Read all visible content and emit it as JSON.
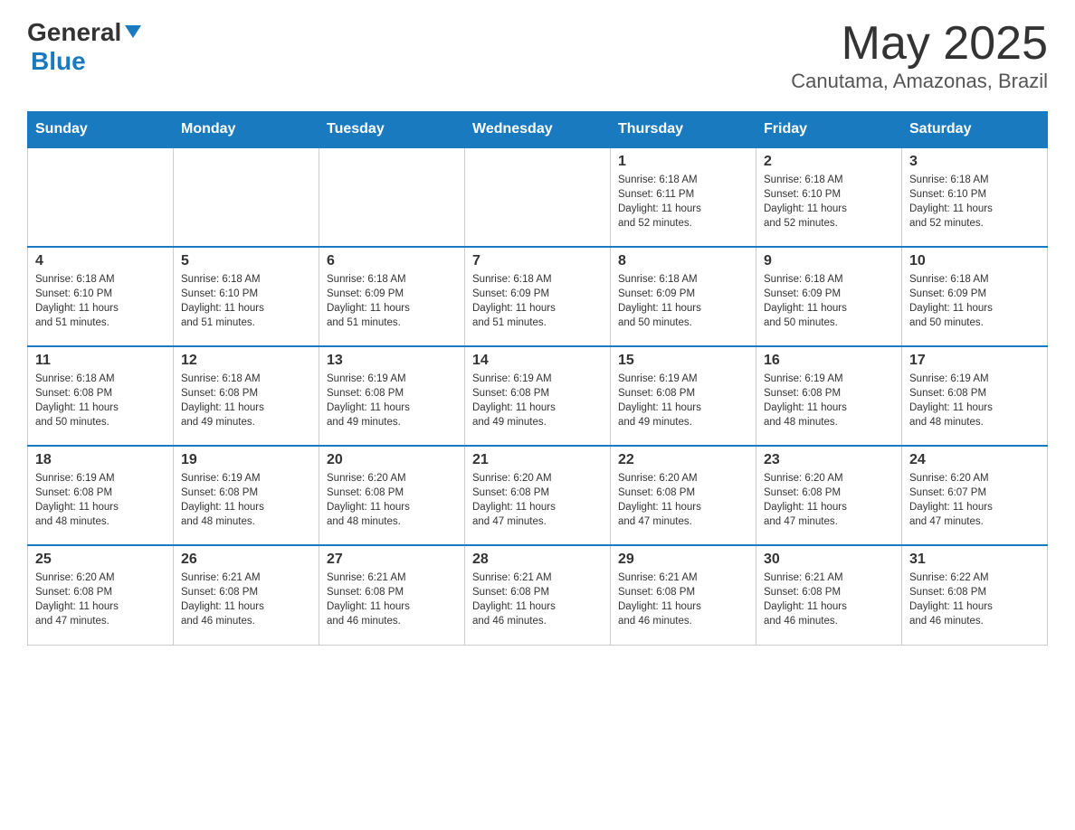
{
  "header": {
    "logo_general": "General",
    "logo_blue": "Blue",
    "month": "May 2025",
    "location": "Canutama, Amazonas, Brazil"
  },
  "days_of_week": [
    "Sunday",
    "Monday",
    "Tuesday",
    "Wednesday",
    "Thursday",
    "Friday",
    "Saturday"
  ],
  "weeks": [
    [
      {
        "day": "",
        "info": ""
      },
      {
        "day": "",
        "info": ""
      },
      {
        "day": "",
        "info": ""
      },
      {
        "day": "",
        "info": ""
      },
      {
        "day": "1",
        "info": "Sunrise: 6:18 AM\nSunset: 6:11 PM\nDaylight: 11 hours\nand 52 minutes."
      },
      {
        "day": "2",
        "info": "Sunrise: 6:18 AM\nSunset: 6:10 PM\nDaylight: 11 hours\nand 52 minutes."
      },
      {
        "day": "3",
        "info": "Sunrise: 6:18 AM\nSunset: 6:10 PM\nDaylight: 11 hours\nand 52 minutes."
      }
    ],
    [
      {
        "day": "4",
        "info": "Sunrise: 6:18 AM\nSunset: 6:10 PM\nDaylight: 11 hours\nand 51 minutes."
      },
      {
        "day": "5",
        "info": "Sunrise: 6:18 AM\nSunset: 6:10 PM\nDaylight: 11 hours\nand 51 minutes."
      },
      {
        "day": "6",
        "info": "Sunrise: 6:18 AM\nSunset: 6:09 PM\nDaylight: 11 hours\nand 51 minutes."
      },
      {
        "day": "7",
        "info": "Sunrise: 6:18 AM\nSunset: 6:09 PM\nDaylight: 11 hours\nand 51 minutes."
      },
      {
        "day": "8",
        "info": "Sunrise: 6:18 AM\nSunset: 6:09 PM\nDaylight: 11 hours\nand 50 minutes."
      },
      {
        "day": "9",
        "info": "Sunrise: 6:18 AM\nSunset: 6:09 PM\nDaylight: 11 hours\nand 50 minutes."
      },
      {
        "day": "10",
        "info": "Sunrise: 6:18 AM\nSunset: 6:09 PM\nDaylight: 11 hours\nand 50 minutes."
      }
    ],
    [
      {
        "day": "11",
        "info": "Sunrise: 6:18 AM\nSunset: 6:08 PM\nDaylight: 11 hours\nand 50 minutes."
      },
      {
        "day": "12",
        "info": "Sunrise: 6:18 AM\nSunset: 6:08 PM\nDaylight: 11 hours\nand 49 minutes."
      },
      {
        "day": "13",
        "info": "Sunrise: 6:19 AM\nSunset: 6:08 PM\nDaylight: 11 hours\nand 49 minutes."
      },
      {
        "day": "14",
        "info": "Sunrise: 6:19 AM\nSunset: 6:08 PM\nDaylight: 11 hours\nand 49 minutes."
      },
      {
        "day": "15",
        "info": "Sunrise: 6:19 AM\nSunset: 6:08 PM\nDaylight: 11 hours\nand 49 minutes."
      },
      {
        "day": "16",
        "info": "Sunrise: 6:19 AM\nSunset: 6:08 PM\nDaylight: 11 hours\nand 48 minutes."
      },
      {
        "day": "17",
        "info": "Sunrise: 6:19 AM\nSunset: 6:08 PM\nDaylight: 11 hours\nand 48 minutes."
      }
    ],
    [
      {
        "day": "18",
        "info": "Sunrise: 6:19 AM\nSunset: 6:08 PM\nDaylight: 11 hours\nand 48 minutes."
      },
      {
        "day": "19",
        "info": "Sunrise: 6:19 AM\nSunset: 6:08 PM\nDaylight: 11 hours\nand 48 minutes."
      },
      {
        "day": "20",
        "info": "Sunrise: 6:20 AM\nSunset: 6:08 PM\nDaylight: 11 hours\nand 48 minutes."
      },
      {
        "day": "21",
        "info": "Sunrise: 6:20 AM\nSunset: 6:08 PM\nDaylight: 11 hours\nand 47 minutes."
      },
      {
        "day": "22",
        "info": "Sunrise: 6:20 AM\nSunset: 6:08 PM\nDaylight: 11 hours\nand 47 minutes."
      },
      {
        "day": "23",
        "info": "Sunrise: 6:20 AM\nSunset: 6:08 PM\nDaylight: 11 hours\nand 47 minutes."
      },
      {
        "day": "24",
        "info": "Sunrise: 6:20 AM\nSunset: 6:07 PM\nDaylight: 11 hours\nand 47 minutes."
      }
    ],
    [
      {
        "day": "25",
        "info": "Sunrise: 6:20 AM\nSunset: 6:08 PM\nDaylight: 11 hours\nand 47 minutes."
      },
      {
        "day": "26",
        "info": "Sunrise: 6:21 AM\nSunset: 6:08 PM\nDaylight: 11 hours\nand 46 minutes."
      },
      {
        "day": "27",
        "info": "Sunrise: 6:21 AM\nSunset: 6:08 PM\nDaylight: 11 hours\nand 46 minutes."
      },
      {
        "day": "28",
        "info": "Sunrise: 6:21 AM\nSunset: 6:08 PM\nDaylight: 11 hours\nand 46 minutes."
      },
      {
        "day": "29",
        "info": "Sunrise: 6:21 AM\nSunset: 6:08 PM\nDaylight: 11 hours\nand 46 minutes."
      },
      {
        "day": "30",
        "info": "Sunrise: 6:21 AM\nSunset: 6:08 PM\nDaylight: 11 hours\nand 46 minutes."
      },
      {
        "day": "31",
        "info": "Sunrise: 6:22 AM\nSunset: 6:08 PM\nDaylight: 11 hours\nand 46 minutes."
      }
    ]
  ]
}
